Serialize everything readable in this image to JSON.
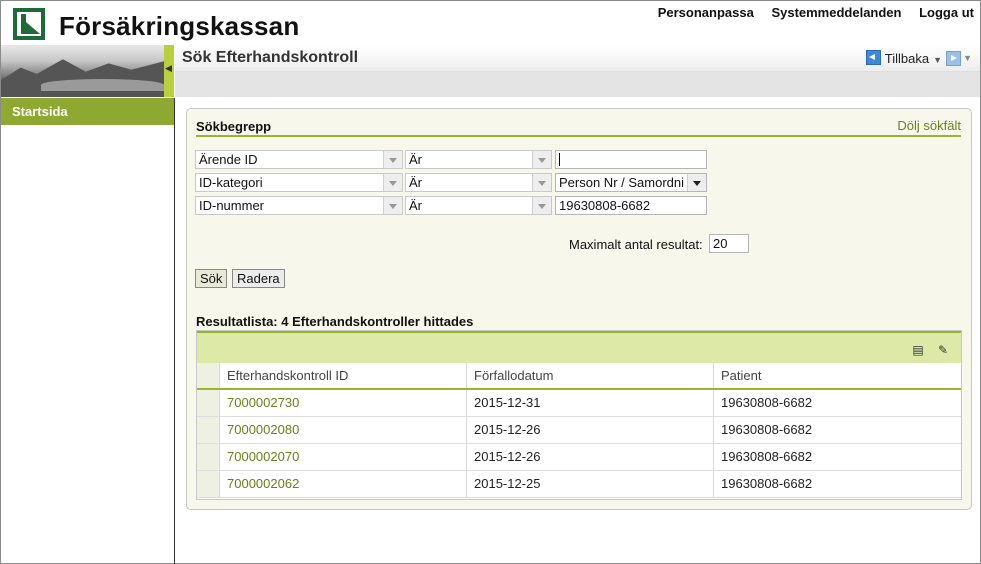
{
  "header": {
    "logo_text": "Försäkringskassan",
    "links": [
      "Personanpassa",
      "Systemmeddelanden",
      "Logga ut"
    ]
  },
  "nav": {
    "startsida": "Startsida"
  },
  "titlebar": {
    "title": "Sök Efterhandskontroll",
    "back_label": "Tillbaka"
  },
  "search": {
    "section_title": "Sökbegrepp",
    "hide_link": "Dölj sökfält",
    "rows": [
      {
        "field": "Ärende ID",
        "operator": "Är",
        "value": ""
      },
      {
        "field": "ID-kategori",
        "operator": "Är",
        "value": "Person Nr / Samordni"
      },
      {
        "field": "ID-nummer",
        "operator": "Är",
        "value": "19630808-6682"
      }
    ],
    "max_results_label": "Maximalt antal resultat:",
    "max_results_value": "20",
    "search_button": "Sök",
    "clear_button": "Radera"
  },
  "results": {
    "title": "Resultatlista: 4 Efterhandskontroller hittades",
    "toolbar_icons": [
      "export-icon",
      "wrench-icon"
    ],
    "columns": [
      "Efterhandskontroll ID",
      "Förfallodatum",
      "Patient"
    ],
    "rows": [
      {
        "id": "7000002730",
        "date": "2015-12-31",
        "patient": "19630808-6682"
      },
      {
        "id": "7000002080",
        "date": "2015-12-26",
        "patient": "19630808-6682"
      },
      {
        "id": "7000002070",
        "date": "2015-12-26",
        "patient": "19630808-6682"
      },
      {
        "id": "7000002062",
        "date": "2015-12-25",
        "patient": "19630808-6682"
      }
    ]
  },
  "colors": {
    "brand_green": "#1e6b3a",
    "accent_olive": "#8fa832",
    "link_olive": "#6b7f1a",
    "toolbar_green": "#dde9a6"
  }
}
